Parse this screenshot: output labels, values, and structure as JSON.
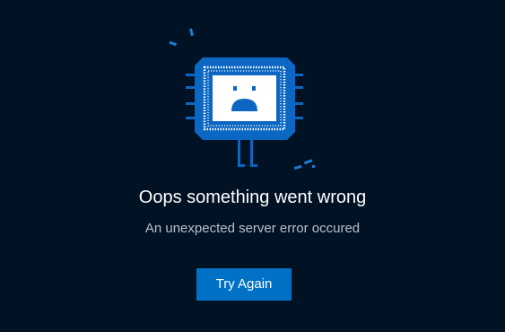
{
  "error": {
    "title": "Oops something went wrong",
    "message": "An unexpected server error occured"
  },
  "actions": {
    "retry_label": "Try Again"
  },
  "illustration": {
    "icon": "sad-chip-icon"
  },
  "colors": {
    "background": "#001224",
    "accent": "#0071c5",
    "chip_blue": "#0b67c2",
    "screen": "#ffffff"
  }
}
